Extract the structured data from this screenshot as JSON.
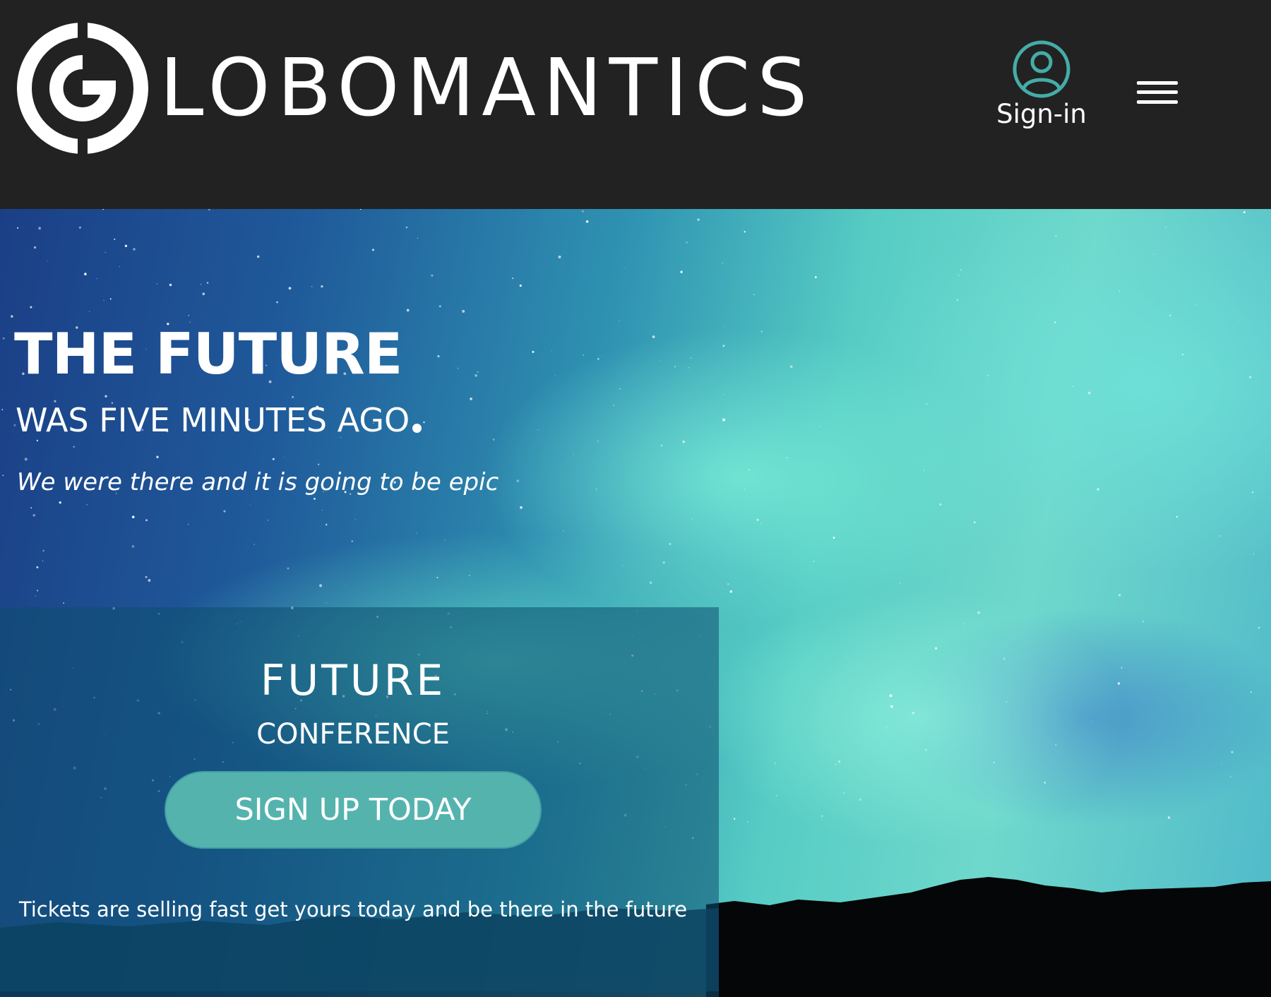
{
  "header": {
    "logo_text": "LOBOMANTICS",
    "logo_mark": "globomantics-g-logo",
    "signin": {
      "label": "Sign-in",
      "icon": "user-circle-icon",
      "icon_color": "#45aca7"
    },
    "menu_icon": "hamburger-menu-icon",
    "background": "#222222"
  },
  "hero": {
    "title": "THE FUTURE",
    "subtitle": "WAS FIVE MINUTES AGO",
    "tagline": "We were there and it is going to be epic",
    "background": "aurora-night-sky"
  },
  "card": {
    "title": "FUTURE",
    "subtitle": "CONFERENCE",
    "button_label": "SIGN UP TODAY",
    "note": "Tickets are selling fast get yours today and be there in the future",
    "button_color": "#55b3ae"
  }
}
